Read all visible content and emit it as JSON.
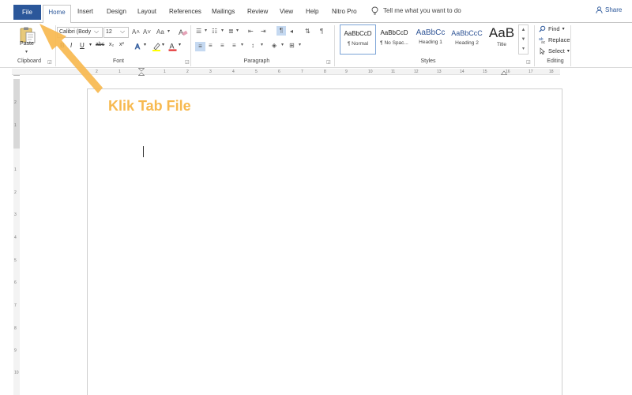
{
  "tabs": [
    "File",
    "Home",
    "Insert",
    "Design",
    "Layout",
    "References",
    "Mailings",
    "Review",
    "View",
    "Help",
    "Nitro Pro"
  ],
  "tell_me": "Tell me what you want to do",
  "share": "Share",
  "clipboard": {
    "paste_label": "Paste",
    "group_label": "Clipboard"
  },
  "font": {
    "name": "Calibri (Body",
    "size": "12",
    "grow": "A˄",
    "shrink": "A˅",
    "case": "Aa",
    "bold": "B",
    "italic": "I",
    "underline": "U",
    "strike": "abc",
    "subscript": "x₂",
    "superscript": "x²",
    "group_label": "Font"
  },
  "paragraph": {
    "group_label": "Paragraph"
  },
  "styles": {
    "items": [
      {
        "sample": "AaBbCcD",
        "name": "¶ Normal"
      },
      {
        "sample": "AaBbCcD",
        "name": "¶ No Spac..."
      },
      {
        "sample": "AaBbCc",
        "name": "Heading 1"
      },
      {
        "sample": "AaBbCcC",
        "name": "Heading 2"
      },
      {
        "sample": "AaB",
        "name": "Title"
      }
    ],
    "group_label": "Styles"
  },
  "editing": {
    "find": "Find",
    "replace": "Replace",
    "select": "Select",
    "group_label": "Editing"
  },
  "ruler": {
    "h_labels": [
      "2",
      "1",
      "1",
      "2",
      "3",
      "4",
      "5",
      "6",
      "7",
      "8",
      "9",
      "10",
      "11",
      "12",
      "13",
      "14",
      "15",
      "16",
      "17",
      "18"
    ],
    "v_labels": [
      "2",
      "1",
      "1",
      "2",
      "3",
      "4",
      "5",
      "6",
      "7",
      "8",
      "9",
      "10"
    ],
    "corner": "L"
  },
  "annotation": {
    "text": "Klik Tab File"
  },
  "colors": {
    "accent": "#2b579a",
    "callout": "#f7b94f"
  }
}
